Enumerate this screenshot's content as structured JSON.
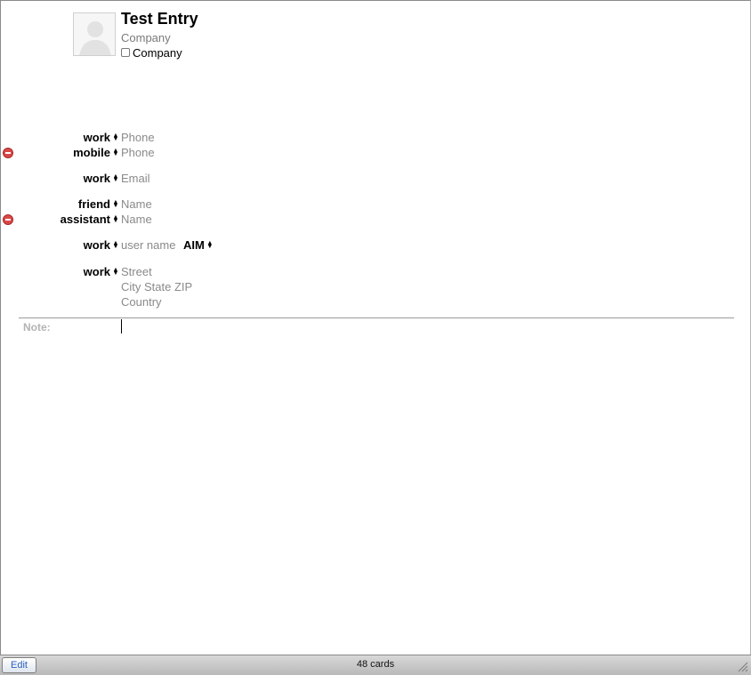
{
  "card": {
    "name": "Test Entry",
    "company_placeholder": "Company",
    "company_checkbox_label": "Company"
  },
  "fields": {
    "phone_work": {
      "label": "work",
      "value": "Phone"
    },
    "phone_mobile": {
      "label": "mobile",
      "value": "Phone"
    },
    "email_work": {
      "label": "work",
      "value": "Email"
    },
    "related_friend": {
      "label": "friend",
      "value": "Name"
    },
    "related_assistant": {
      "label": "assistant",
      "value": "Name"
    },
    "im_work": {
      "label": "work",
      "value": "user name",
      "service": "AIM"
    },
    "address_work": {
      "label": "work",
      "street": "Street",
      "city_line": "City State ZIP",
      "country": "Country"
    }
  },
  "note": {
    "label": "Note:"
  },
  "footer": {
    "edit_label": "Edit",
    "count": "48 cards"
  },
  "icons": {
    "avatar": "person-silhouette-icon",
    "remove": "minus-circle-icon",
    "popup": "up-down-arrows-icon",
    "resize": "resize-grip-icon"
  },
  "colors": {
    "remove": "#d94848",
    "placeholder": "#8a8a8a",
    "edit_text": "#2a5fc0"
  }
}
